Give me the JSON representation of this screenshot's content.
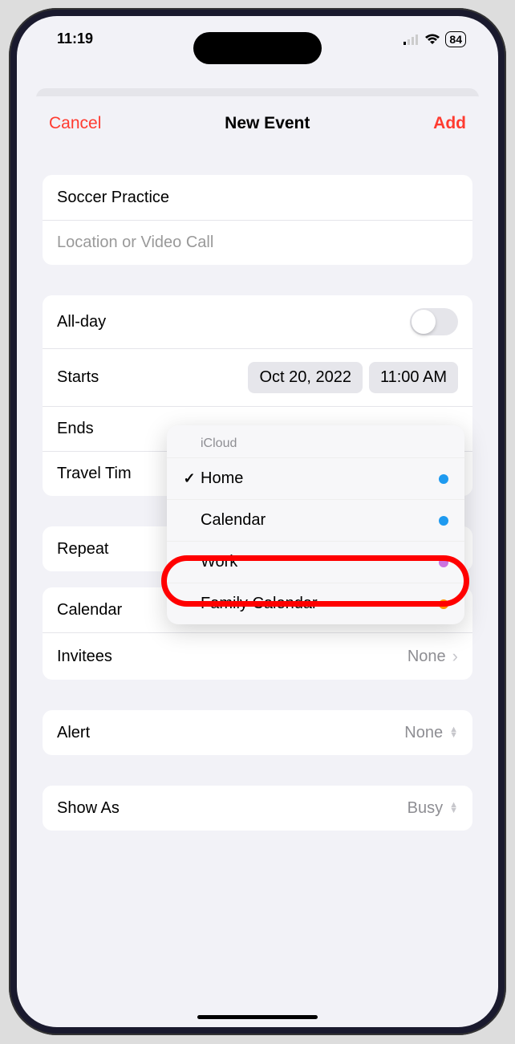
{
  "status": {
    "time": "11:19",
    "battery": "84"
  },
  "nav": {
    "cancel": "Cancel",
    "title": "New Event",
    "add": "Add"
  },
  "event": {
    "title": "Soccer Practice",
    "location_placeholder": "Location or Video Call"
  },
  "rows": {
    "allday": "All-day",
    "starts": "Starts",
    "starts_date": "Oct 20, 2022",
    "starts_time": "11:00 AM",
    "ends": "Ends",
    "travel": "Travel Tim",
    "repeat": "Repeat",
    "calendar": "Calendar",
    "calendar_value": "Home",
    "invitees": "Invitees",
    "invitees_value": "None",
    "alert": "Alert",
    "alert_value": "None",
    "showas": "Show As",
    "showas_value": "Busy"
  },
  "popover": {
    "header": "iCloud",
    "items": [
      {
        "label": "Home",
        "color": "blue",
        "checked": true
      },
      {
        "label": "Calendar",
        "color": "blue",
        "checked": false
      },
      {
        "label": "Work",
        "color": "purple",
        "checked": false
      },
      {
        "label": "Family Calendar",
        "color": "orange",
        "checked": false
      }
    ]
  }
}
